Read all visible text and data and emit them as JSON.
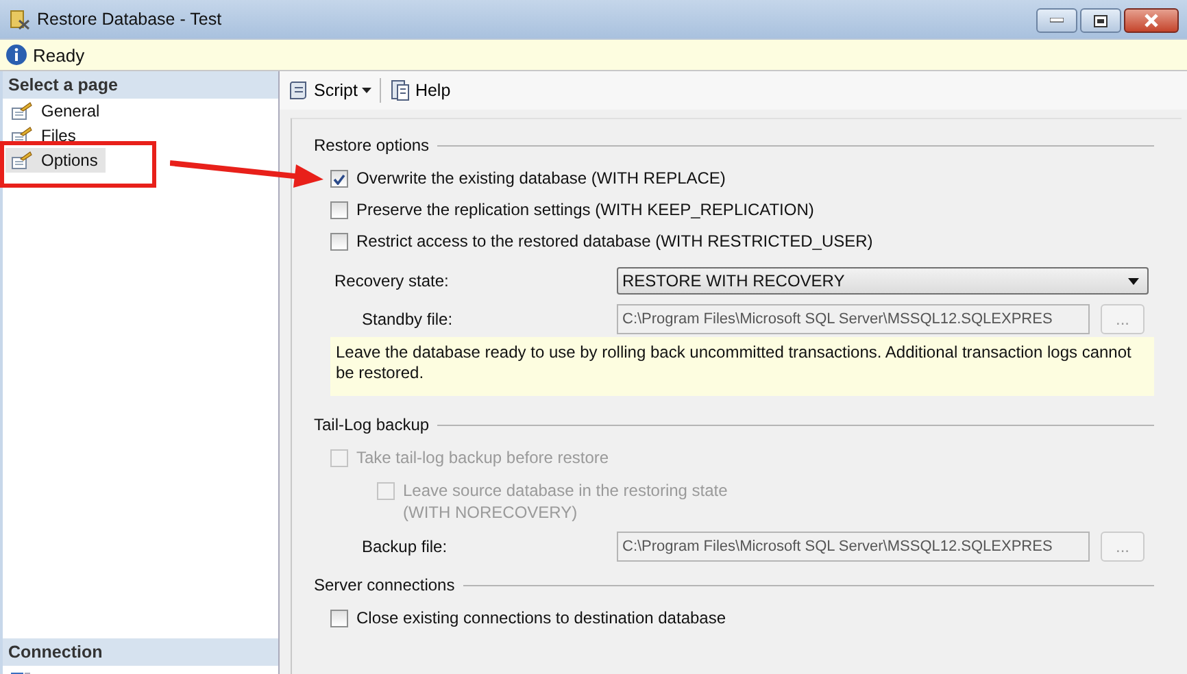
{
  "window": {
    "title": "Restore Database - Test"
  },
  "status": {
    "text": "Ready"
  },
  "sidebar": {
    "header": "Select a page",
    "items": [
      {
        "label": "General",
        "selected": false
      },
      {
        "label": "Files",
        "selected": false
      },
      {
        "label": "Options",
        "selected": true
      }
    ],
    "connection_header": "Connection"
  },
  "toolbar": [
    {
      "label": "Script",
      "kind": "dropdown"
    },
    {
      "label": "Help",
      "kind": "help"
    }
  ],
  "sections": [
    {
      "title": "Restore options",
      "items": [
        {
          "kind": "checkbox",
          "label": "Overwrite the existing database (WITH REPLACE)",
          "checked": true,
          "disabled": false
        },
        {
          "kind": "checkbox",
          "label": "Preserve the replication settings (WITH KEEP_REPLICATION)",
          "checked": false,
          "disabled": false
        },
        {
          "kind": "checkbox",
          "label": "Restrict access to the restored database (WITH RESTRICTED_USER)",
          "checked": false,
          "disabled": false
        },
        {
          "kind": "dropdown",
          "label": "Recovery state:",
          "value": "RESTORE WITH RECOVERY",
          "disabled": false
        },
        {
          "kind": "file",
          "label": "Standby file:",
          "value": "C:\\Program Files\\Microsoft SQL Server\\MSSQL12.SQLEXPRES",
          "button": "...",
          "disabled": true
        },
        {
          "kind": "note",
          "text": "Leave the database ready to use by rolling back uncommitted transactions. Additional transaction logs cannot be restored."
        }
      ]
    },
    {
      "title": "Tail-Log backup",
      "items": [
        {
          "kind": "checkbox",
          "label": "Take tail-log backup before restore",
          "checked": false,
          "disabled": true,
          "children": [
            {
              "kind": "checkbox",
              "label": "Leave source database in the restoring state\n(WITH NORECOVERY)",
              "checked": false,
              "disabled": true
            }
          ]
        },
        {
          "kind": "file",
          "label": "Backup file:",
          "value": "C:\\Program Files\\Microsoft SQL Server\\MSSQL12.SQLEXPRES",
          "button": "...",
          "disabled": true
        }
      ]
    },
    {
      "title": "Server connections",
      "items": [
        {
          "kind": "checkbox",
          "label": "Close existing connections to destination database",
          "checked": false,
          "disabled": false
        }
      ]
    }
  ]
}
